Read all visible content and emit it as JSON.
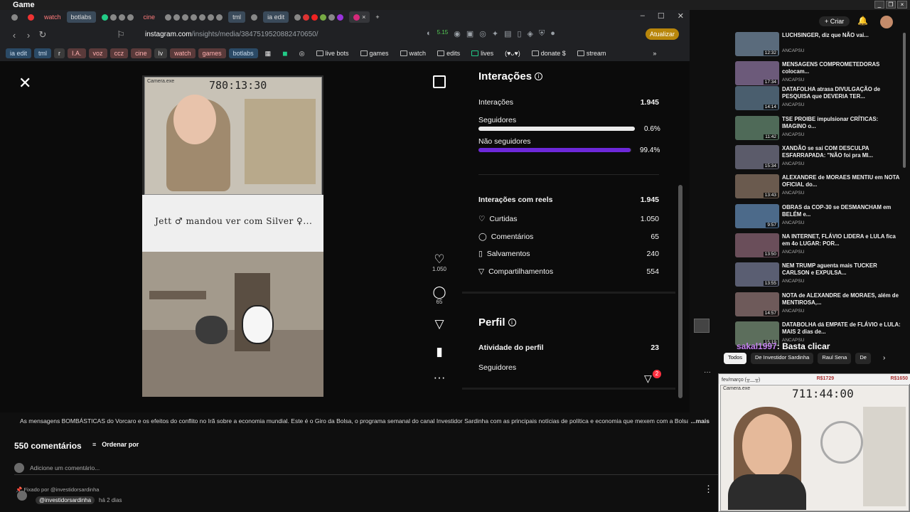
{
  "os": {
    "title": "Game"
  },
  "browser": {
    "tabs": [
      {
        "label": "",
        "kind": "icon"
      },
      {
        "label": "",
        "kind": "icon"
      },
      {
        "label": "watch",
        "kind": "red"
      },
      {
        "label": "botlabs",
        "kind": "hl"
      },
      {
        "label": "cine",
        "kind": "red"
      },
      {
        "label": "tml",
        "kind": "hl"
      },
      {
        "label": "ia edit",
        "kind": "hl"
      }
    ],
    "url_host": "instagram.com",
    "url_path": "/insights/media/3847519520882470650/",
    "update_label": "Atualizar",
    "bookmarks": [
      {
        "label": "ia edit",
        "style": "blue"
      },
      {
        "label": "tml",
        "style": "blue"
      },
      {
        "label": "r",
        "style": "plain-dark"
      },
      {
        "label": "I.A.",
        "style": "pink"
      },
      {
        "label": "voz",
        "style": "pink"
      },
      {
        "label": "ccz",
        "style": "pink"
      },
      {
        "label": "cine",
        "style": "pink"
      },
      {
        "label": "lv",
        "style": "plain-dark"
      },
      {
        "label": "watch",
        "style": "pink"
      },
      {
        "label": "games",
        "style": "pink"
      },
      {
        "label": "botlabs",
        "style": "blue"
      },
      {
        "label": "live bots",
        "style": "folder"
      },
      {
        "label": "games",
        "style": "folder"
      },
      {
        "label": "watch",
        "style": "folder"
      },
      {
        "label": "edits",
        "style": "folder"
      },
      {
        "label": "lives",
        "style": "folder"
      },
      {
        "label": "(♥ᴗ♥)",
        "style": "plain"
      },
      {
        "label": "donate $",
        "style": "folder"
      },
      {
        "label": "stream",
        "style": "folder"
      }
    ],
    "ext_counter": "5.15"
  },
  "media": {
    "cam_timer": "780:13:30",
    "cam_caption": "Camera.exe",
    "overlay_text": "Jett ♂ mandou ver com Silver ♀...",
    "likes": "1.050",
    "comments": "65"
  },
  "insights": {
    "interactions_title": "Interações",
    "interactions_label": "Interações",
    "interactions_value": "1.945",
    "followers_label": "Seguidores",
    "followers_pct": "0.6%",
    "followers_frac": 0.006,
    "nonfollowers_label": "Não seguidores",
    "nonfollowers_pct": "99.4%",
    "nonfollowers_frac": 0.994,
    "reels_label": "Interações com reels",
    "reels_value": "1.945",
    "metrics": [
      {
        "label": "Curtidas",
        "value": "1.050",
        "icon": "heart-icon"
      },
      {
        "label": "Comentários",
        "value": "65",
        "icon": "comment-icon"
      },
      {
        "label": "Salvamentos",
        "value": "240",
        "icon": "bookmark-icon"
      },
      {
        "label": "Compartilhamentos",
        "value": "554",
        "icon": "share-icon"
      }
    ],
    "profile_title": "Perfil",
    "profile_activity_label": "Atividade do perfil",
    "profile_activity_value": "23",
    "profile_followers_label": "Seguidores",
    "share_badge": "2",
    "colors": {
      "followers_bar": "#ffffff",
      "nonfollowers_bar": "#6d28d9"
    }
  },
  "youtube": {
    "description": "As mensagens BOMBÁSTICAS do Vorcaro e os efeitos do conflito no Irã sobre a economia mundial. Este é o Giro da Bolsa, o programa semanal do canal Investidor Sardinha com as principais notícias de política e economia que mexem com a Bolsa de",
    "more_label": "...mais",
    "comment_count": "550 comentários",
    "sort_label": "Ordenar por",
    "add_comment_placeholder": "Adicione um comentário...",
    "pinned_label": "Fixado por @investidorsardinha",
    "pinned_author": "@investidorsardinha",
    "pinned_time": "há 2 dias",
    "create_label": "Criar",
    "chat_user": "sakal1997",
    "chat_text": ": Basta clicar",
    "chips": [
      "Todos",
      "De Investidor Sardinha",
      "Raul Sena",
      "De"
    ],
    "videos": [
      {
        "title": "LUCHSINGER, diz que NÃO vai...",
        "channel": "ANCAPSU",
        "duration": "12:32"
      },
      {
        "title": "MENSAGENS COMPROMETEDORAS colocam...",
        "channel": "ANCAPSU",
        "duration": "17:34"
      },
      {
        "title": "DATAFOLHA atrasa DIVULGAÇÃO de PESQUISA que DEVERIA TER...",
        "channel": "ANCAPSU",
        "duration": "14:14"
      },
      {
        "title": "TSE PROIBE impulsionar CRÍTICAS: IMAGINO o...",
        "channel": "ANCAPSU",
        "duration": "11:42"
      },
      {
        "title": "XANDÃO se sai COM DESCULPA ESFARRAPADA: \"NÃO foi pra MI...",
        "channel": "ANCAPSU",
        "duration": "15:34"
      },
      {
        "title": "ALEXANDRE de MORAES MENTIU em NOTA OFICIAL do...",
        "channel": "ANCAPSU",
        "duration": "13:43"
      },
      {
        "title": "OBRAS da COP-30 se DESMANCHAM em BELÉM e...",
        "channel": "ANCAPSU",
        "duration": "9:57"
      },
      {
        "title": "NA INTERNET, FLÁVIO LIDERA e LULA fica em 4o LUGAR: POR...",
        "channel": "ANCAPSU",
        "duration": "13:50"
      },
      {
        "title": "NEM TRUMP aguenta mais TUCKER CARLSON e EXPULSA...",
        "channel": "ANCAPSU",
        "duration": "13:55"
      },
      {
        "title": "NOTA de ALEXANDRE de MORAES, além de MENTIROSA,...",
        "channel": "ANCAPSU",
        "duration": "14:57"
      },
      {
        "title": "DATABOLHA dá EMPATE de FLÁVIO e LULA: MAIS 2 dias de...",
        "channel": "ANCAPSU",
        "duration": "15:19"
      }
    ]
  },
  "webcam": {
    "header_left": "fev/março (╥﹏╥)",
    "price_left": "R$1729",
    "price_right": "R$1650",
    "caption": "Camera.exe",
    "timer": "711:44:00"
  }
}
